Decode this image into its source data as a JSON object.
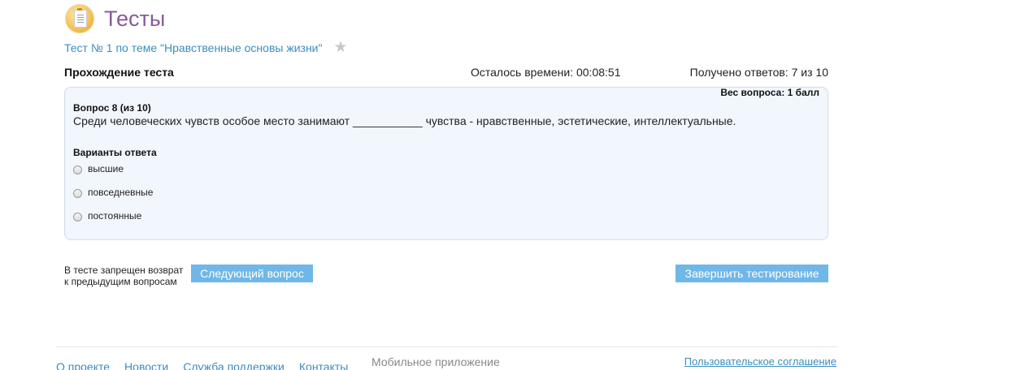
{
  "header": {
    "title": "Тесты",
    "logo_icon": "clipboard-icon"
  },
  "test": {
    "title": "Тест № 1 по теме \"Нравственные основы жизни\"",
    "favorite_icon": "star-icon"
  },
  "status": {
    "heading": "Прохождение теста",
    "time_left": "Осталось времени: 00:08:51",
    "answers_received": "Получено ответов: 7 из 10"
  },
  "question": {
    "weight": "Вес вопроса: 1 балл",
    "number": "Вопрос 8 (из 10)",
    "text": "Среди человеческих чувств особое место занимают ___________ чувства - нравственные, эстетические, интеллектуальные.",
    "variants_label": "Варианты ответа",
    "options": [
      {
        "label": "высшие",
        "selected": false
      },
      {
        "label": "повседневные",
        "selected": false
      },
      {
        "label": "постоянные",
        "selected": false
      }
    ]
  },
  "navigation": {
    "forbidden_note_line1": "В тесте запрещен возврат",
    "forbidden_note_line2": "к предыдущим вопросам",
    "next_label": "Следующий вопрос",
    "finish_label": "Завершить тестирование"
  },
  "footer": {
    "links": [
      "О проекте",
      "Новости",
      "Служба поддержки",
      "Контакты"
    ],
    "mobile_app": "Мобильное приложение",
    "agreement": "Пользовательское соглашение"
  },
  "colors": {
    "accent_blue": "#3a8ec0",
    "button_blue": "#6fb7e8",
    "title_purple": "#8a5a9a",
    "question_bg": "#f2f6fd"
  }
}
